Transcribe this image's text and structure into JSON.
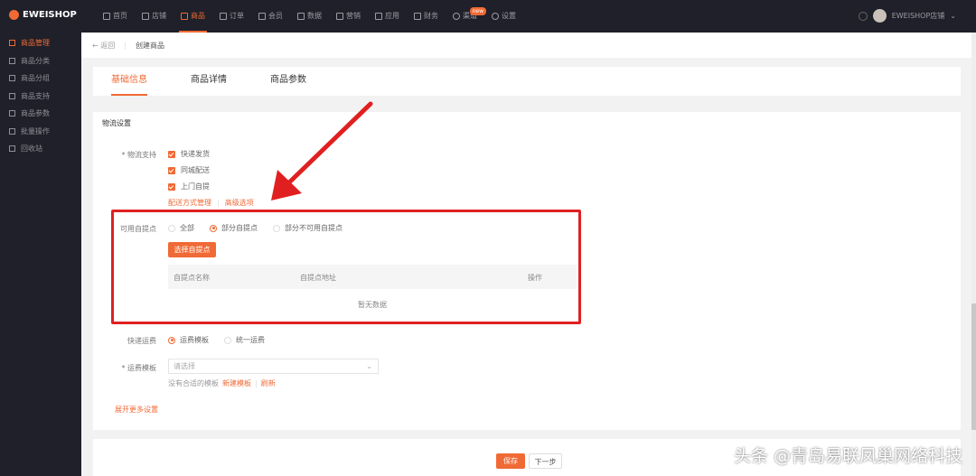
{
  "brand": "EWEISHOP",
  "nav": [
    {
      "label": "首页"
    },
    {
      "label": "店铺"
    },
    {
      "label": "商品",
      "active": true
    },
    {
      "label": "订单"
    },
    {
      "label": "会员"
    },
    {
      "label": "数据"
    },
    {
      "label": "营销"
    },
    {
      "label": "应用"
    },
    {
      "label": "财务"
    },
    {
      "label": "渠道",
      "badge": "new"
    },
    {
      "label": "设置"
    }
  ],
  "user": {
    "name": "EWEISHOP店铺"
  },
  "sidebar": [
    {
      "label": "商品管理",
      "active": true
    },
    {
      "label": "商品分类"
    },
    {
      "label": "商品分组"
    },
    {
      "label": "商品支持"
    },
    {
      "label": "商品参数"
    },
    {
      "label": "批量操作"
    },
    {
      "label": "回收站"
    }
  ],
  "breadcrumb": {
    "back": "← 返回",
    "current": "创建商品"
  },
  "tabs": [
    {
      "label": "基础信息",
      "active": true
    },
    {
      "label": "商品详情"
    },
    {
      "label": "商品参数"
    }
  ],
  "form": {
    "section": "物流设置",
    "logistics_label": "* 物流支持",
    "logistics": [
      "快递发货",
      "同城配送",
      "上门自提"
    ],
    "links": [
      "配送方式管理",
      "高级选项"
    ],
    "pickup_label": "可用自提点",
    "pickup_options": [
      "全部",
      "部分自提点",
      "部分不可用自提点"
    ],
    "select_pickup_btn": "选择自提点",
    "table_headers": [
      "自提点名称",
      "自提点地址",
      "操作"
    ],
    "empty": "暂无数据",
    "freight_label": "快递运费",
    "freight_options": [
      "运费模板",
      "统一运费"
    ],
    "template_label": "* 运费模板",
    "template_placeholder": "请选择",
    "template_hint": "没有合适的模板",
    "template_new": "新建模板",
    "template_refresh": "刷新",
    "more": "展开更多设置"
  },
  "footer": {
    "save": "保存",
    "next": "下一步"
  },
  "watermark": "头条 @青岛易联凤巢网络科技",
  "colors": {
    "accent": "#f06a35",
    "dark": "#1f2029",
    "highlight": "#e02020"
  }
}
